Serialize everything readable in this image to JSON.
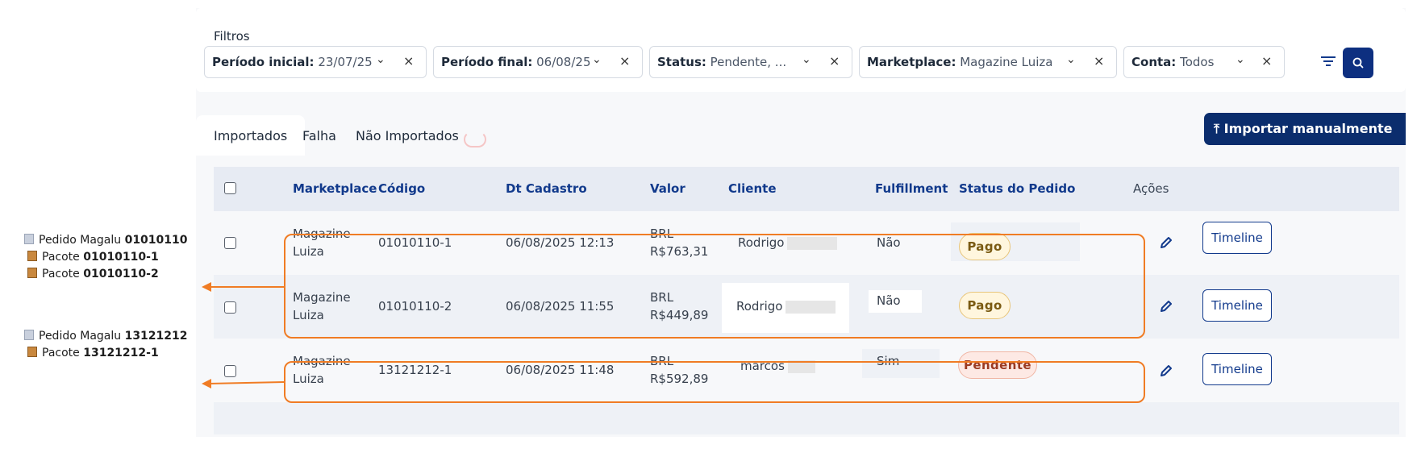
{
  "filters": {
    "title": "Filtros",
    "chips": [
      {
        "key": "Período inicial",
        "value": "23/07/25"
      },
      {
        "key": "Período final",
        "value": "06/08/25"
      },
      {
        "key": "Status",
        "value": "Pendente, ..."
      },
      {
        "key": "Marketplace",
        "value": "Magazine Luiza"
      },
      {
        "key": "Conta",
        "value": "Todos"
      }
    ],
    "sep": ":",
    "chevron": "⌄",
    "clear": "×"
  },
  "tabs": {
    "imported": "Importados",
    "failed": "Falha",
    "not_imported": "Não Importados"
  },
  "import_button": "⤒ Importar manualmente",
  "table": {
    "headers": {
      "marketplace": "Marketplace",
      "code": "Código",
      "date": "Dt Cadastro",
      "value": "Valor",
      "client": "Cliente",
      "fulfillment": "Fulfillment",
      "status": "Status do Pedido",
      "actions": "Ações"
    },
    "rows": [
      {
        "mp1": "Magazine",
        "mp2": "Luiza",
        "code": "01010110-1",
        "date": "06/08/2025 12:13",
        "cur": "BRL",
        "amount": "R$763,31",
        "client": "Rodrigo",
        "fulfillment": "Não",
        "status": "Pago"
      },
      {
        "mp1": "Magazine",
        "mp2": "Luiza",
        "code": "01010110-2",
        "date": "06/08/2025 11:55",
        "cur": "BRL",
        "amount": "R$449,89",
        "client": "Rodrigo",
        "fulfillment": "Não",
        "status": "Pago"
      },
      {
        "mp1": "Magazine",
        "mp2": "Luiza",
        "code": "13121212-1",
        "date": "06/08/2025 11:48",
        "cur": "BRL",
        "amount": "R$592,89",
        "client": "marcos",
        "fulfillment": "Sim",
        "status": "Pendente"
      }
    ],
    "timeline_label": "Timeline"
  },
  "annotations": {
    "group1": [
      {
        "prefix": "Pedido Magalu ",
        "bold": "01010110"
      },
      {
        "prefix": "Pacote ",
        "bold": "01010110-1"
      },
      {
        "prefix": "Pacote ",
        "bold": "01010110-2"
      }
    ],
    "group2": [
      {
        "prefix": "Pedido Magalu ",
        "bold": "13121212"
      },
      {
        "prefix": "Pacote ",
        "bold": "13121212-1"
      }
    ]
  },
  "colors": {
    "accent": "#0d2f80",
    "highlight": "#f07c24"
  },
  "icons": {
    "filter": "filter-lines-icon",
    "search": "search-icon",
    "edit": "pencil-icon",
    "order": "document-icon",
    "package": "package-icon"
  }
}
